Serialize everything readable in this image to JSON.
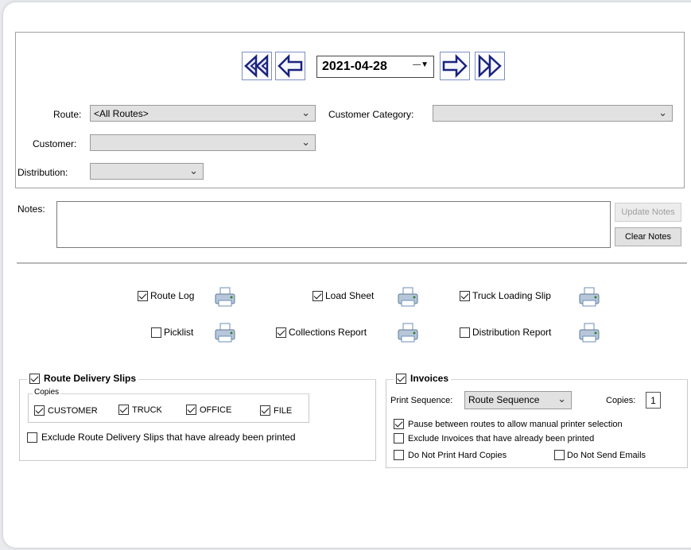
{
  "nav": {
    "date": "2021-04-28",
    "first_icon": "double-left-arrow-icon",
    "prev_icon": "left-arrow-icon",
    "next_icon": "right-arrow-icon",
    "last_icon": "double-right-arrow-icon"
  },
  "filters": {
    "route_label": "Route:",
    "route_value": "<All Routes>",
    "customer_category_label": "Customer Category:",
    "customer_category_value": "",
    "customer_label": "Customer:",
    "customer_value": "",
    "distribution_label": "Distribution:",
    "distribution_value": ""
  },
  "notes": {
    "label": "Notes:",
    "value": "",
    "update_button": "Update Notes",
    "clear_button": "Clear Notes"
  },
  "reports": [
    {
      "label": "Route Log",
      "checked": true
    },
    {
      "label": "Load Sheet",
      "checked": true
    },
    {
      "label": "Truck Loading Slip",
      "checked": true
    },
    {
      "label": "Picklist",
      "checked": false
    },
    {
      "label": "Collections Report",
      "checked": true
    },
    {
      "label": "Distribution Report",
      "checked": false
    }
  ],
  "delivery_slips": {
    "title": "Route Delivery Slips",
    "checked": true,
    "copies_label": "Copies",
    "copies": [
      {
        "label": "CUSTOMER",
        "checked": true
      },
      {
        "label": "TRUCK",
        "checked": true
      },
      {
        "label": "OFFICE",
        "checked": true
      },
      {
        "label": "FILE",
        "checked": true
      }
    ],
    "exclude_label": "Exclude Route Delivery Slips that have already been printed",
    "exclude_checked": false
  },
  "invoices": {
    "title": "Invoices",
    "checked": true,
    "print_sequence_label": "Print Sequence:",
    "print_sequence_value": "Route Sequence",
    "copies_label": "Copies:",
    "copies_value": "1",
    "pause_label": "Pause between routes to allow manual printer selection",
    "pause_checked": true,
    "exclude_label": "Exclude Invoices that have already been printed",
    "exclude_checked": false,
    "no_hard_copies_label": "Do Not Print Hard Copies",
    "no_hard_copies_checked": false,
    "no_emails_label": "Do Not Send Emails",
    "no_emails_checked": false
  },
  "colors": {
    "arrow_blue": "#1a237e",
    "arrow_fill": "#2d3fa8",
    "select_bg": "#e1e1e1"
  }
}
